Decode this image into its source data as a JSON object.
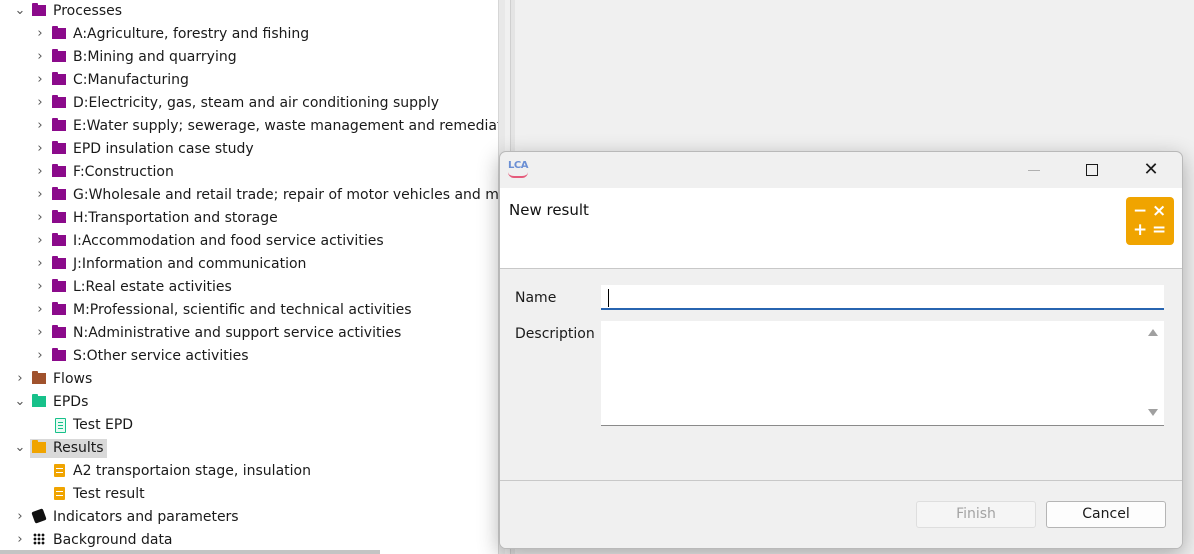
{
  "tree": {
    "rows": [
      {
        "label": "Processes",
        "expanded": true,
        "icon": "folder-purple-icon"
      },
      {
        "label": "A:Agriculture, forestry and fishing",
        "icon": "folder-purple-icon"
      },
      {
        "label": "B:Mining and quarrying",
        "icon": "folder-purple-icon"
      },
      {
        "label": "C:Manufacturing",
        "icon": "folder-purple-icon"
      },
      {
        "label": "D:Electricity, gas, steam and air conditioning supply",
        "icon": "folder-purple-icon"
      },
      {
        "label": "E:Water supply; sewerage, waste management and remediation",
        "icon": "folder-purple-icon"
      },
      {
        "label": "EPD insulation case study",
        "icon": "folder-purple-icon"
      },
      {
        "label": "F:Construction",
        "icon": "folder-purple-icon"
      },
      {
        "label": "G:Wholesale and retail trade; repair of motor vehicles and motorcycles",
        "icon": "folder-purple-icon"
      },
      {
        "label": "H:Transportation and storage",
        "icon": "folder-purple-icon"
      },
      {
        "label": "I:Accommodation and food service activities",
        "icon": "folder-purple-icon"
      },
      {
        "label": "J:Information and communication",
        "icon": "folder-purple-icon"
      },
      {
        "label": "L:Real estate activities",
        "icon": "folder-purple-icon"
      },
      {
        "label": "M:Professional, scientific and technical activities",
        "icon": "folder-purple-icon"
      },
      {
        "label": "N:Administrative and support service activities",
        "icon": "folder-purple-icon"
      },
      {
        "label": "S:Other service activities",
        "icon": "folder-purple-icon"
      },
      {
        "label": "Flows",
        "icon": "folder-brown-icon"
      },
      {
        "label": "EPDs",
        "expanded": true,
        "icon": "folder-green-icon"
      },
      {
        "label": "Test EPD",
        "icon": "epd-icon"
      },
      {
        "label": "Results",
        "expanded": true,
        "selected": true,
        "icon": "folder-orange-icon"
      },
      {
        "label": "A2 transportaion stage, insulation",
        "icon": "result-icon"
      },
      {
        "label": "Test result",
        "icon": "result-icon"
      },
      {
        "label": "Indicators and parameters",
        "icon": "indicators-icon"
      },
      {
        "label": "Background data",
        "icon": "background-data-icon"
      }
    ]
  },
  "dialog": {
    "title": "New result",
    "window_buttons": {
      "minimize": "—",
      "maximize": "□",
      "close": "✕"
    },
    "calc_icon_glyphs": [
      "−",
      "×",
      "+",
      "="
    ],
    "name_label": "Name",
    "name_value": "",
    "description_label": "Description",
    "description_value": "",
    "finish_label": "Finish",
    "cancel_label": "Cancel"
  },
  "colors": {
    "processes_folder": "#8b0a8b",
    "flows_folder": "#a0522d",
    "epd_folder": "#17c18a",
    "results_folder": "#f0a400",
    "accent": "#2764b0"
  }
}
